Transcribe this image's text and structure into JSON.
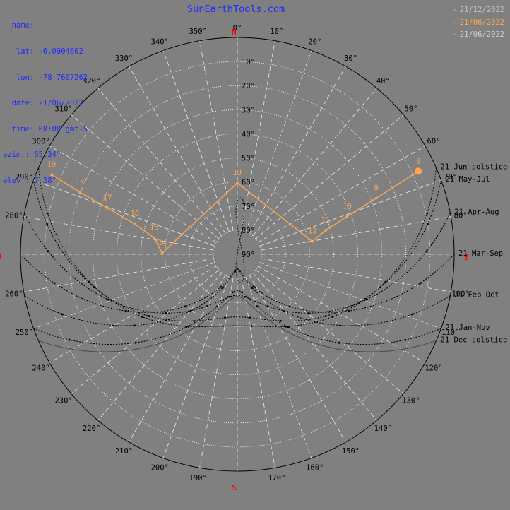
{
  "site": {
    "title": "SunEarthTools.com"
  },
  "info": {
    "labels": [
      "name:",
      "lat:",
      "lon:",
      "date:",
      "time:",
      "azim.:",
      "elev.:"
    ],
    "values": [
      "",
      "-6.0904602",
      "-78.7607262",
      "21/06/2022",
      "08:00 gmt-5",
      "65.34°",
      "7.38°"
    ]
  },
  "legend": [
    {
      "dash": "-",
      "text": "21/12/2022",
      "color": "#c0c0c0"
    },
    {
      "dash": "-",
      "text": "21/06/2022",
      "color": "#ffa64d"
    },
    {
      "dash": "-",
      "text": "21/06/2022",
      "color": "#cfcfcf"
    }
  ],
  "colors": {
    "background": "#808080",
    "sun_path": "#ffa64d",
    "compass": "#ff0000",
    "text": "#1f2cff",
    "grid": "#ffffff"
  },
  "chart_data": {
    "type": "polar-sunpath",
    "title": "SunEarthTools.com",
    "cardinals": {
      "N": "N",
      "E": "E",
      "S": "S",
      "W": "W"
    },
    "azimuth_ticks": [
      "0°",
      "10°",
      "20°",
      "30°",
      "40°",
      "50°",
      "60°",
      "70°",
      "80°",
      "100°",
      "110°",
      "120°",
      "130°",
      "140°",
      "150°",
      "160°",
      "170°",
      "190°",
      "200°",
      "210°",
      "220°",
      "230°",
      "240°",
      "250°",
      "260°",
      "280°",
      "290°",
      "300°",
      "310°",
      "320°",
      "330°",
      "340°",
      "350°"
    ],
    "elevation_ticks": [
      "10°",
      "20°",
      "30°",
      "40°",
      "50°",
      "60°",
      "70°",
      "80°",
      "90°"
    ],
    "sun_position": {
      "azimuth": 65.34,
      "elevation": 7.38
    },
    "today_path": {
      "date": "21/06/2022",
      "hours": [
        "19",
        "18",
        "17",
        "16",
        "15",
        "14",
        "13",
        "12",
        "11",
        "10",
        "9",
        "8"
      ],
      "points": [
        {
          "hour": "19",
          "azimuth": 293.2,
          "elevation": 6.1
        },
        {
          "hour": "18",
          "azimuth": 291.5,
          "elevation": 19.8
        },
        {
          "hour": "17",
          "azimuth": 289.6,
          "elevation": 32.8
        },
        {
          "hour": "16",
          "azimuth": 286.5,
          "elevation": 45.6
        },
        {
          "hour": "15",
          "azimuth": 281.2,
          "elevation": 54.8
        },
        {
          "hour": "14",
          "azimuth": 271.0,
          "elevation": 58.8
        },
        {
          "hour": "13",
          "azimuth": 0.0,
          "elevation": 60.4
        },
        {
          "hour": "12",
          "azimuth": 80.2,
          "elevation": 58.4
        },
        {
          "hour": "11",
          "azimuth": 74.8,
          "elevation": 52.0
        },
        {
          "hour": "10",
          "azimuth": 71.0,
          "elevation": 41.8
        },
        {
          "hour": "9",
          "azimuth": 68.0,
          "elevation": 27.8
        },
        {
          "hour": "8",
          "azimuth": 65.34,
          "elevation": 7.38
        }
      ]
    },
    "monthly_paths": [
      {
        "label": "21 Jun  solstice",
        "sunrise_azimuth": 66.5,
        "noon_elevation": 60.4
      },
      {
        "label": "21 May-Jul",
        "sunrise_azimuth": 70.0,
        "noon_elevation": 64.0
      },
      {
        "label": "21 Apr-Aug",
        "sunrise_azimuth": 79.0,
        "noon_elevation": 73.0
      },
      {
        "label": "21 Mar-Sep",
        "sunrise_azimuth": 90.0,
        "noon_elevation": 84.0
      },
      {
        "label": "21 Feb-Oct",
        "sunrise_azimuth": 101.0,
        "noon_elevation": 84.0
      },
      {
        "label": "21 Jan-Nov",
        "sunrise_azimuth": 110.0,
        "noon_elevation": 75.0
      },
      {
        "label": "21 Dec  solstice",
        "sunrise_azimuth": 113.5,
        "noon_elevation": 72.5
      }
    ],
    "grid": true
  }
}
